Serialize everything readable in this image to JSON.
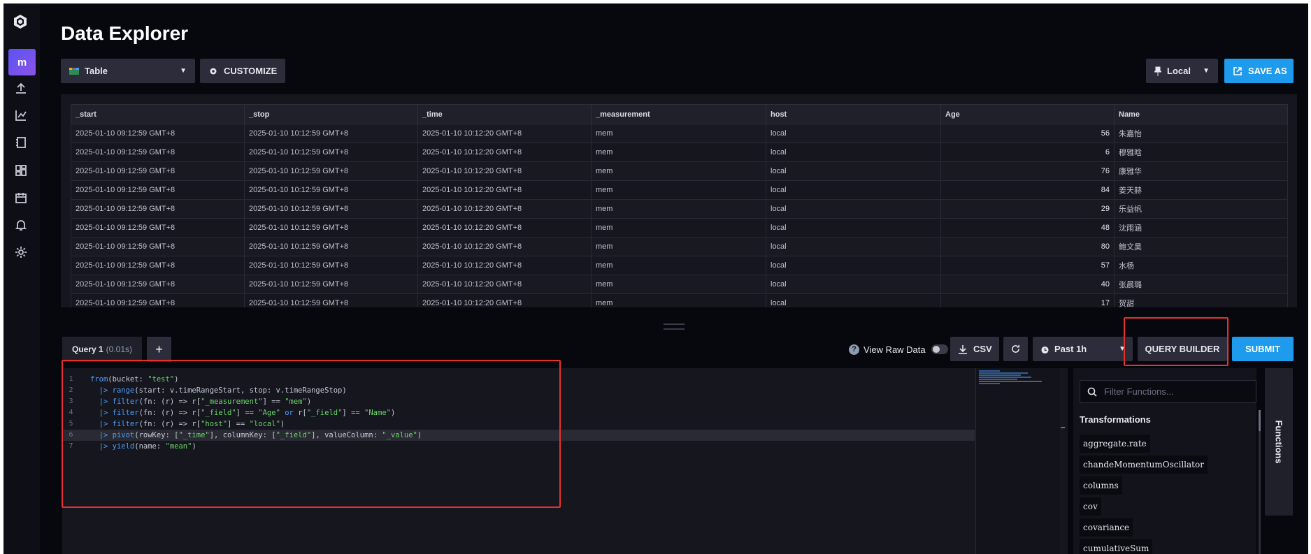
{
  "page": {
    "title": "Data Explorer"
  },
  "sidebar": {
    "user_initial": "m",
    "icons": [
      "logo-icon",
      "upload-icon",
      "graph-icon",
      "notebook-icon",
      "dashboard-icon",
      "calendar-icon",
      "bell-icon",
      "gear-icon"
    ]
  },
  "toolbar": {
    "view_type": "Table",
    "customize_label": "CUSTOMIZE",
    "timezone": "Local",
    "save_as_label": "SAVE AS"
  },
  "table": {
    "columns": [
      "_start",
      "_stop",
      "_time",
      "_measurement",
      "host",
      "Age",
      "Name"
    ],
    "rows": [
      [
        "2025-01-10 09:12:59 GMT+8",
        "2025-01-10 10:12:59 GMT+8",
        "2025-01-10 10:12:20 GMT+8",
        "mem",
        "local",
        "56",
        "朱嘉怡"
      ],
      [
        "2025-01-10 09:12:59 GMT+8",
        "2025-01-10 10:12:59 GMT+8",
        "2025-01-10 10:12:20 GMT+8",
        "mem",
        "local",
        "6",
        "穆雅晗"
      ],
      [
        "2025-01-10 09:12:59 GMT+8",
        "2025-01-10 10:12:59 GMT+8",
        "2025-01-10 10:12:20 GMT+8",
        "mem",
        "local",
        "76",
        "康雅华"
      ],
      [
        "2025-01-10 09:12:59 GMT+8",
        "2025-01-10 10:12:59 GMT+8",
        "2025-01-10 10:12:20 GMT+8",
        "mem",
        "local",
        "84",
        "姜天赫"
      ],
      [
        "2025-01-10 09:12:59 GMT+8",
        "2025-01-10 10:12:59 GMT+8",
        "2025-01-10 10:12:20 GMT+8",
        "mem",
        "local",
        "29",
        "乐益帆"
      ],
      [
        "2025-01-10 09:12:59 GMT+8",
        "2025-01-10 10:12:59 GMT+8",
        "2025-01-10 10:12:20 GMT+8",
        "mem",
        "local",
        "48",
        "沈雨涵"
      ],
      [
        "2025-01-10 09:12:59 GMT+8",
        "2025-01-10 10:12:59 GMT+8",
        "2025-01-10 10:12:20 GMT+8",
        "mem",
        "local",
        "80",
        "鲍文昊"
      ],
      [
        "2025-01-10 09:12:59 GMT+8",
        "2025-01-10 10:12:59 GMT+8",
        "2025-01-10 10:12:20 GMT+8",
        "mem",
        "local",
        "57",
        "水杨"
      ],
      [
        "2025-01-10 09:12:59 GMT+8",
        "2025-01-10 10:12:59 GMT+8",
        "2025-01-10 10:12:20 GMT+8",
        "mem",
        "local",
        "40",
        "张晨璐"
      ],
      [
        "2025-01-10 09:12:59 GMT+8",
        "2025-01-10 10:12:59 GMT+8",
        "2025-01-10 10:12:20 GMT+8",
        "mem",
        "local",
        "17",
        "贺甜"
      ]
    ]
  },
  "query": {
    "tab_label": "Query 1",
    "tab_time": "(0.01s)",
    "add_label": "+",
    "view_raw_label": "View Raw Data",
    "csv_label": "CSV",
    "time_range": "Past 1h",
    "query_builder_label": "QUERY BUILDER",
    "submit_label": "SUBMIT",
    "active_line": 6,
    "code_lines": [
      "from(bucket: \"test\")",
      "  |> range(start: v.timeRangeStart, stop: v.timeRangeStop)",
      "  |> filter(fn: (r) => r[\"_measurement\"] == \"mem\")",
      "  |> filter(fn: (r) => r[\"_field\"] == \"Age\" or r[\"_field\"] == \"Name\")",
      "  |> filter(fn: (r) => r[\"host\"] == \"local\")",
      "  |> pivot(rowKey: [\"_time\"], columnKey: [\"_field\"], valueColumn: \"_value\")",
      "  |> yield(name: \"mean\")"
    ]
  },
  "functions": {
    "search_placeholder": "Filter Functions...",
    "heading": "Transformations",
    "side_tab": "Functions",
    "items": [
      "aggregate.rate",
      "chandeMomentumOscillator",
      "columns",
      "cov",
      "covariance",
      "cumulativeSum"
    ]
  },
  "colors": {
    "accent_blue": "#1f9bee",
    "highlight_red": "#e8302e",
    "background": "#07070e"
  }
}
